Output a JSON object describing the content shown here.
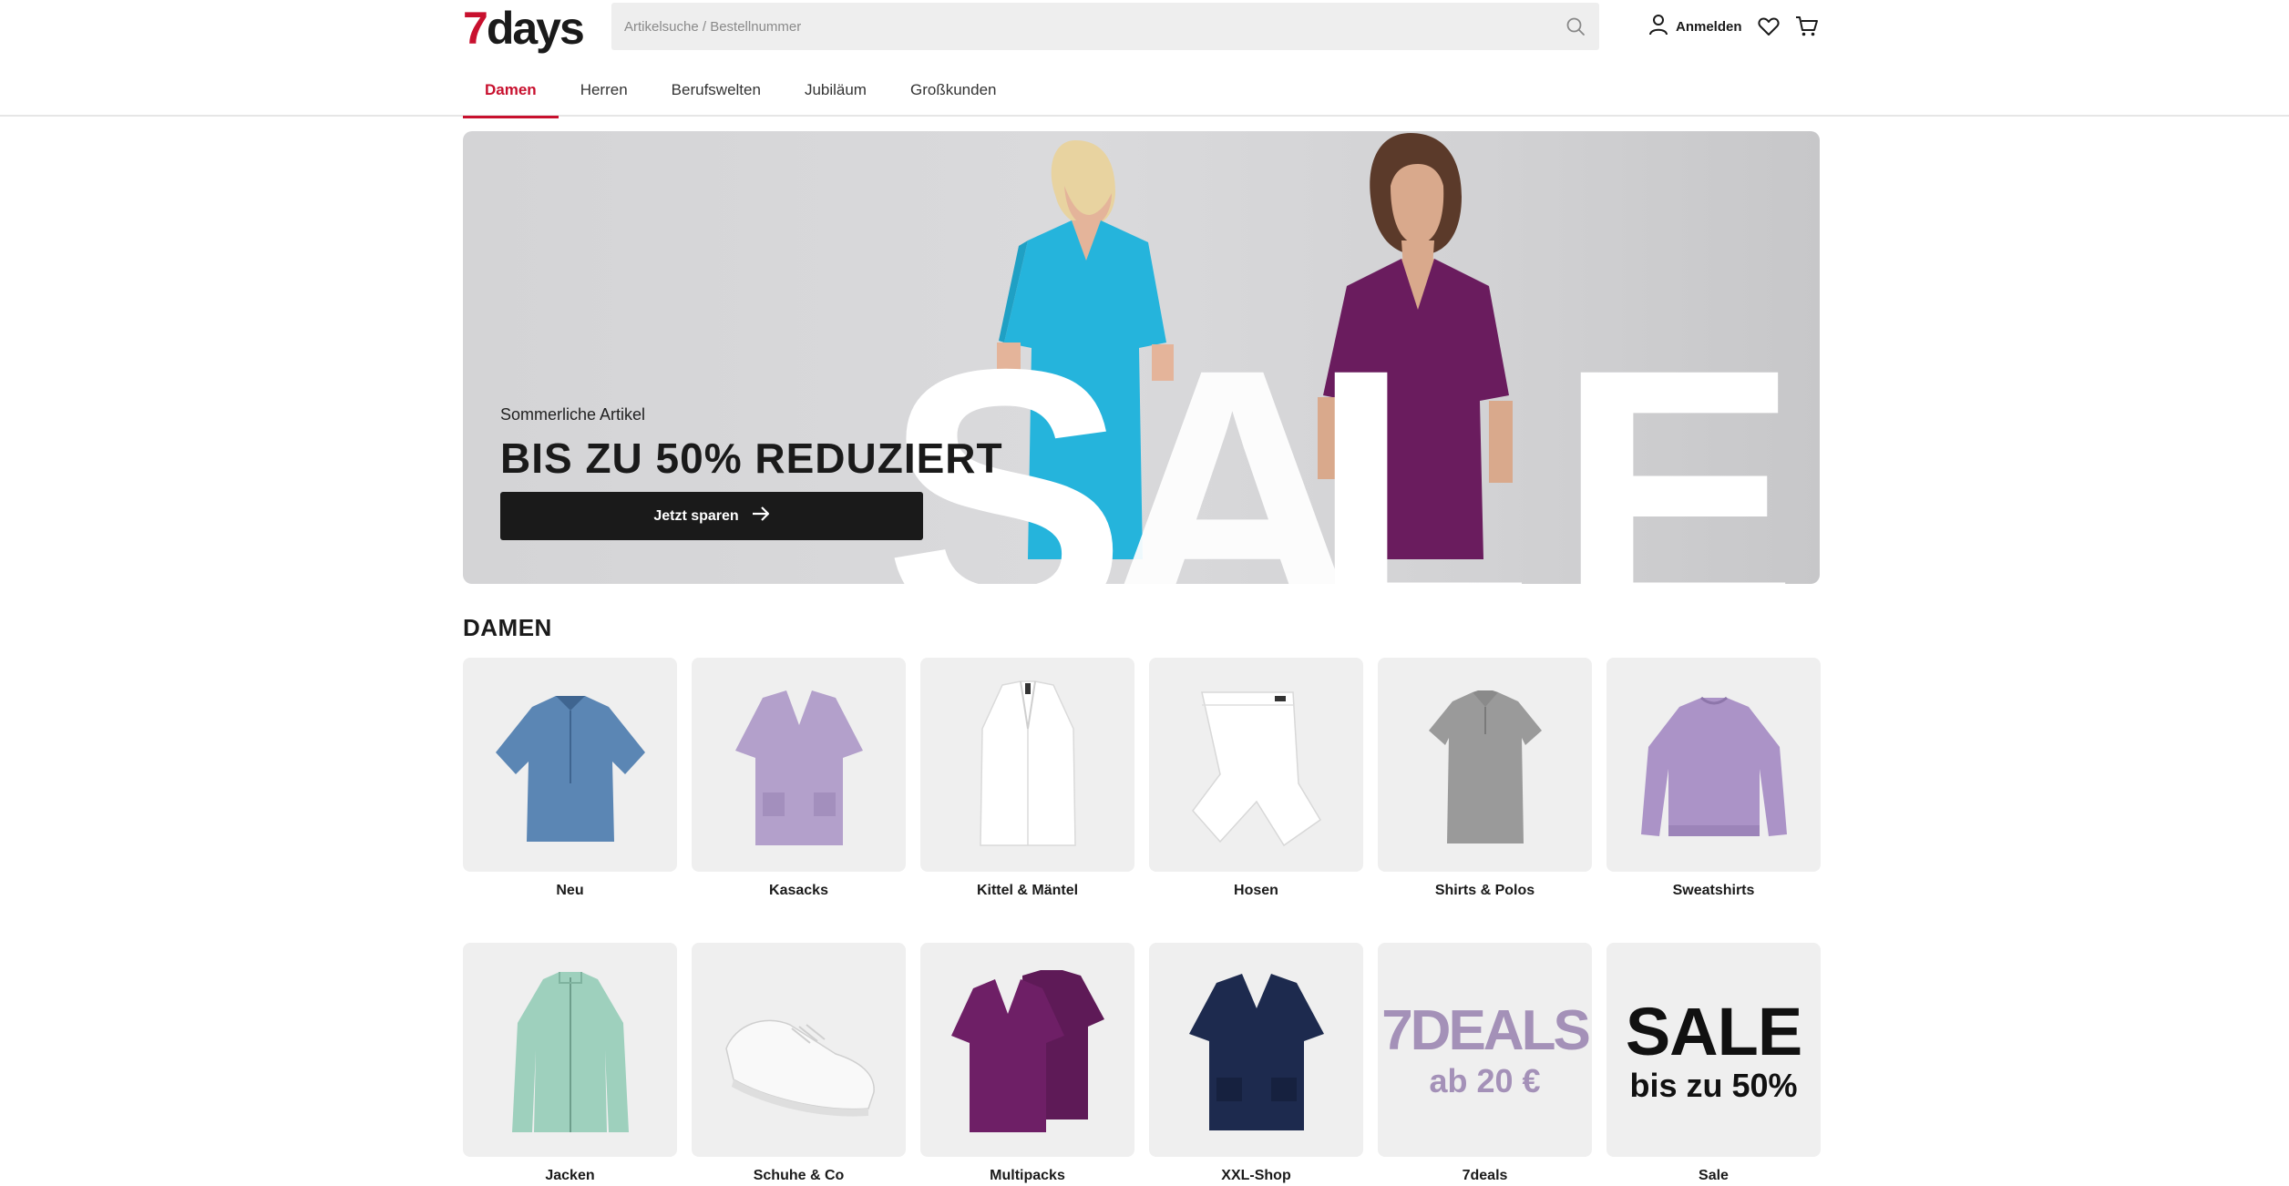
{
  "brand": {
    "logo_seven": "7",
    "logo_days": "days",
    "accent": "#c8102e"
  },
  "search": {
    "placeholder": "Artikelsuche / Bestellnummer",
    "icon": "search-icon"
  },
  "header_actions": {
    "login_label": "Anmelden",
    "login_icon": "user-icon",
    "wishlist_icon": "heart-icon",
    "cart_icon": "cart-icon"
  },
  "nav": {
    "items": [
      {
        "label": "Damen",
        "active": true
      },
      {
        "label": "Herren",
        "active": false
      },
      {
        "label": "Berufswelten",
        "active": false
      },
      {
        "label": "Jubiläum",
        "active": false
      },
      {
        "label": "Großkunden",
        "active": false
      }
    ]
  },
  "hero": {
    "subtitle": "Sommerliche Artikel",
    "title": "BIS ZU 50% REDUZIERT",
    "cta_label": "Jetzt sparen",
    "cta_icon": "arrow-right-icon",
    "big_word": "SALE"
  },
  "section": {
    "title": "DAMEN",
    "categories": [
      {
        "label": "Neu",
        "image": "blue-shirt",
        "color": "#5b86b4"
      },
      {
        "label": "Kasacks",
        "image": "lavender-tunic",
        "color": "#b3a0cb"
      },
      {
        "label": "Kittel & Mäntel",
        "image": "white-coat",
        "color": "#ffffff"
      },
      {
        "label": "Hosen",
        "image": "white-pants",
        "color": "#ffffff"
      },
      {
        "label": "Shirts & Polos",
        "image": "grey-polo",
        "color": "#9a9a9a"
      },
      {
        "label": "Sweatshirts",
        "image": "lavender-sweatshirt",
        "color": "#ab93c7"
      },
      {
        "label": "Jacken",
        "image": "mint-jacket",
        "color": "#9ed0bd"
      },
      {
        "label": "Schuhe & Co",
        "image": "white-sneaker",
        "color": "#f4f4f4"
      },
      {
        "label": "Multipacks",
        "image": "purple-tunics",
        "color": "#6e1f66"
      },
      {
        "label": "XXL-Shop",
        "image": "navy-tunic",
        "color": "#1d2a4e"
      },
      {
        "label": "7deals",
        "image": "deals-text",
        "big": "7DEALS",
        "small": "ab 20 €",
        "color": "#a491b8"
      },
      {
        "label": "Sale",
        "image": "sale-text",
        "big": "SALE",
        "small": "bis zu 50%",
        "color": "#111111"
      }
    ]
  }
}
